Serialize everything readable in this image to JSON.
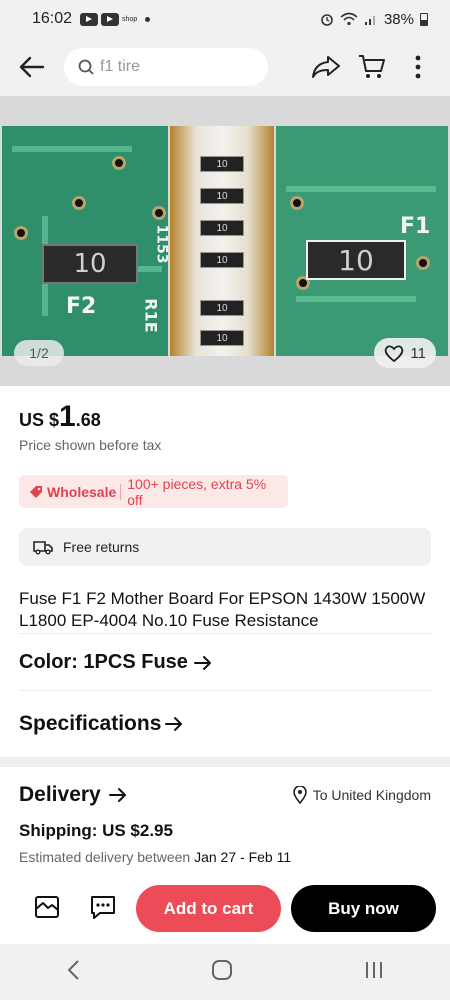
{
  "status_bar": {
    "time": "16:02",
    "shop_label": "shop",
    "battery": "38%"
  },
  "header": {
    "search_text": "f1 tire"
  },
  "gallery": {
    "page_indicator": "1/2",
    "favorites_count": "11"
  },
  "price": {
    "currency": "US $",
    "integer": "1",
    "decimal": ".68",
    "tax_note": "Price shown before tax"
  },
  "promo": {
    "tag": "Wholesale",
    "text": "100+ pieces, extra 5% off"
  },
  "returns": {
    "text": "Free returns"
  },
  "product": {
    "title": "Fuse F1 F2 Mother Board For EPSON 1430W 1500W L1800 EP-4004 No.10 Fuse Resistance",
    "color_label": "Color: 1PCS Fuse",
    "specifications_label": "Specifications"
  },
  "delivery": {
    "title": "Delivery",
    "ship_to": "To United Kingdom",
    "shipping": "Shipping: US $2.95",
    "estimate_prefix": "Estimated delivery between",
    "estimate_dates": "Jan 27 - Feb 11"
  },
  "actions": {
    "add_to_cart": "Add to cart",
    "buy_now": "Buy now"
  },
  "colors": {
    "accent_red": "#ec4c57",
    "promo_bg": "#fde8e8",
    "buy_black": "#000000"
  },
  "image_labels": {
    "chip_1": "10",
    "silk_f2": "F2",
    "silk_1153": "1153",
    "silk_r1": "R1E",
    "chip_3": "10",
    "silk_f1": "F1",
    "tape_1": "10",
    "tape_2": "10",
    "tape_3": "10",
    "tape_4": "10",
    "tape_5": "10",
    "tape_6": "10"
  },
  "icons": {
    "back": "arrow-left-icon",
    "search": "search-icon",
    "share": "share-icon",
    "cart": "cart-icon",
    "more": "more-vertical-icon",
    "heart": "heart-icon",
    "wholesale": "tag-icon",
    "returns": "truck-icon",
    "location": "location-pin-icon",
    "store": "store-icon",
    "chat": "chat-icon"
  }
}
